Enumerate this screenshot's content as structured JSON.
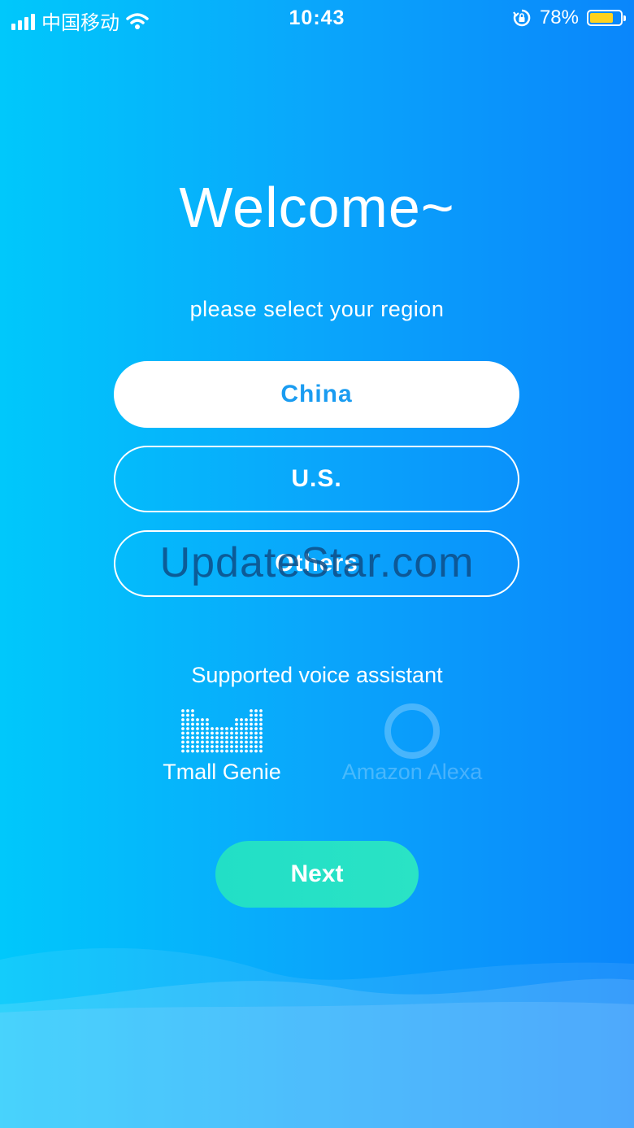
{
  "status_bar": {
    "carrier": "中国移动",
    "time": "10:43",
    "battery": "78%",
    "battery_level": 0.78,
    "icons": [
      "signal-icon",
      "wifi-icon",
      "rotation-lock-icon",
      "battery-icon"
    ]
  },
  "welcome": {
    "title": "Welcome~",
    "subtitle": "please select your region"
  },
  "regions": [
    {
      "label": "China",
      "selected": true
    },
    {
      "label": "U.S.",
      "selected": false
    },
    {
      "label": "Others",
      "selected": false
    }
  ],
  "watermark": "UpdateStar.com",
  "voice": {
    "title": "Supported voice assistant",
    "assistants": [
      {
        "name": "Tmall Genie",
        "active": true,
        "icon": "tmall-genie-icon"
      },
      {
        "name": "Amazon Alexa",
        "active": false,
        "icon": "alexa-icon"
      }
    ]
  },
  "next_label": "Next",
  "colors": {
    "gradient_start": "#00c8fb",
    "gradient_end": "#0a86fb",
    "selected_text": "#1a9cf1",
    "next_button": "#27e1c5",
    "battery_fill": "#ffd21f"
  }
}
